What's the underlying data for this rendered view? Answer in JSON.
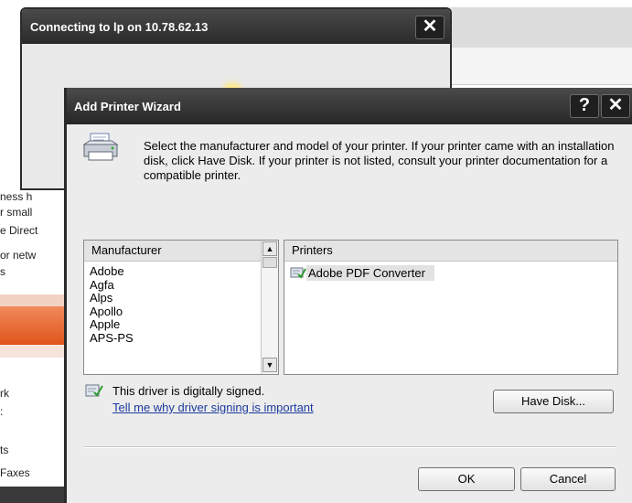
{
  "connect_dialog": {
    "title": "Connecting to lp on 10.78.62.13",
    "close_glyph": "✕"
  },
  "background_left_panel": {
    "lines": [
      "ness h",
      "r small",
      "e Direct",
      "or netw",
      "s",
      "rk",
      ":",
      "ts",
      "Faxes"
    ]
  },
  "wizard": {
    "title": "Add Printer Wizard",
    "help_glyph": "?",
    "close_glyph": "✕",
    "intro": "Select the manufacturer and model of your printer. If your printer came with an installation disk, click Have Disk. If your printer is not listed, consult your printer documentation for a compatible printer.",
    "manufacturer_header": "Manufacturer",
    "manufacturers": [
      {
        "label": "Adobe",
        "selected": true
      },
      {
        "label": "Agfa",
        "selected": false
      },
      {
        "label": "Alps",
        "selected": false
      },
      {
        "label": "Apollo",
        "selected": false
      },
      {
        "label": "Apple",
        "selected": false
      },
      {
        "label": "APS-PS",
        "selected": false
      }
    ],
    "printers_header": "Printers",
    "printers": [
      {
        "label": "Adobe PDF Converter",
        "selected": true,
        "icon": "certified-driver-icon"
      }
    ],
    "signed_text": "This driver is digitally signed.",
    "signed_link": "Tell me why driver signing is important",
    "have_disk_label": "Have Disk...",
    "ok_label": "OK",
    "cancel_label": "Cancel"
  },
  "colors": {
    "titlebar": "#2a2a2a",
    "dialog_bg": "#ececec",
    "link": "#1b3a9e",
    "orange_bar": "#e0541c"
  }
}
